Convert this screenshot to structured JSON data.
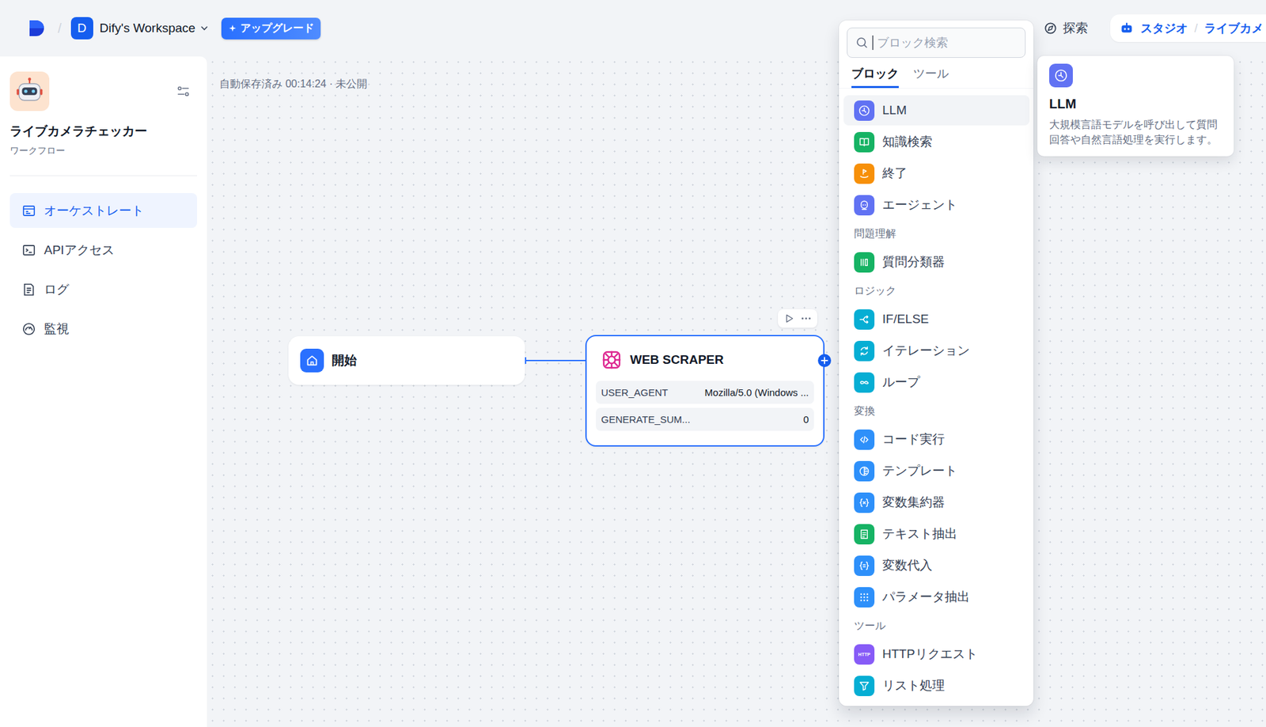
{
  "header": {
    "separator": "/",
    "workspace": {
      "initial": "D",
      "name": "Dify's Workspace"
    },
    "upgrade": "アップグレード",
    "nav": [
      {
        "label": "探索",
        "selected": false
      },
      {
        "label": "スタジオ",
        "selected": true
      }
    ],
    "current_app": "ライブカメ"
  },
  "sidebar": {
    "app_name": "ライブカメラチェッカー",
    "app_type": "ワークフロー",
    "items": [
      {
        "label": "オーケストレート",
        "selected": true
      },
      {
        "label": "APIアクセス",
        "selected": false
      },
      {
        "label": "ログ",
        "selected": false
      },
      {
        "label": "監視",
        "selected": false
      }
    ]
  },
  "canvas": {
    "status": "自動保存済み 00:14:24 · 未公開",
    "start_node": {
      "title": "開始",
      "selected": false
    },
    "tool_node": {
      "title": "WEB SCRAPER",
      "selected": true,
      "params": [
        {
          "name": "USER_AGENT",
          "value": "Mozilla/5.0 (Windows ..."
        },
        {
          "name": "GENERATE_SUM...",
          "value": "0"
        }
      ]
    }
  },
  "block_picker": {
    "search": {
      "placeholder": "ブロック検索"
    },
    "tabs": [
      {
        "label": "ブロック",
        "selected": true
      },
      {
        "label": "ツール",
        "selected": false
      }
    ],
    "groups": [
      {
        "title": "",
        "items": [
          {
            "label": "LLM",
            "color": "#6172f3",
            "selected": true
          },
          {
            "label": "知識検索",
            "color": "#16b364",
            "selected": false
          },
          {
            "label": "終了",
            "color": "#f79009",
            "selected": false
          },
          {
            "label": "エージェント",
            "color": "#6172f3",
            "selected": false
          }
        ]
      },
      {
        "title": "問題理解",
        "items": [
          {
            "label": "質問分類器",
            "color": "#16b364",
            "selected": false
          }
        ]
      },
      {
        "title": "ロジック",
        "items": [
          {
            "label": "IF/ELSE",
            "color": "#06aed4",
            "selected": false
          },
          {
            "label": "イテレーション",
            "color": "#06aed4",
            "selected": false
          },
          {
            "label": "ループ",
            "color": "#06aed4",
            "selected": false
          }
        ]
      },
      {
        "title": "変換",
        "items": [
          {
            "label": "コード実行",
            "color": "#2e90fa",
            "selected": false
          },
          {
            "label": "テンプレート",
            "color": "#2e90fa",
            "selected": false
          },
          {
            "label": "変数集約器",
            "color": "#2e90fa",
            "selected": false
          },
          {
            "label": "テキスト抽出",
            "color": "#16b364",
            "selected": false
          },
          {
            "label": "変数代入",
            "color": "#2e90fa",
            "selected": false
          },
          {
            "label": "パラメータ抽出",
            "color": "#2e90fa",
            "selected": false
          }
        ]
      },
      {
        "title": "ツール",
        "items": [
          {
            "label": "HTTPリクエスト",
            "color": "#875bf7",
            "selected": false,
            "badge": "HTTP"
          },
          {
            "label": "リスト処理",
            "color": "#06aed4",
            "selected": false
          }
        ]
      }
    ]
  },
  "tooltip": {
    "title": "LLM",
    "color": "#6172f3",
    "description": "大規模言語モデルを呼び出して質問回答や自然言語処理を実行します。"
  }
}
